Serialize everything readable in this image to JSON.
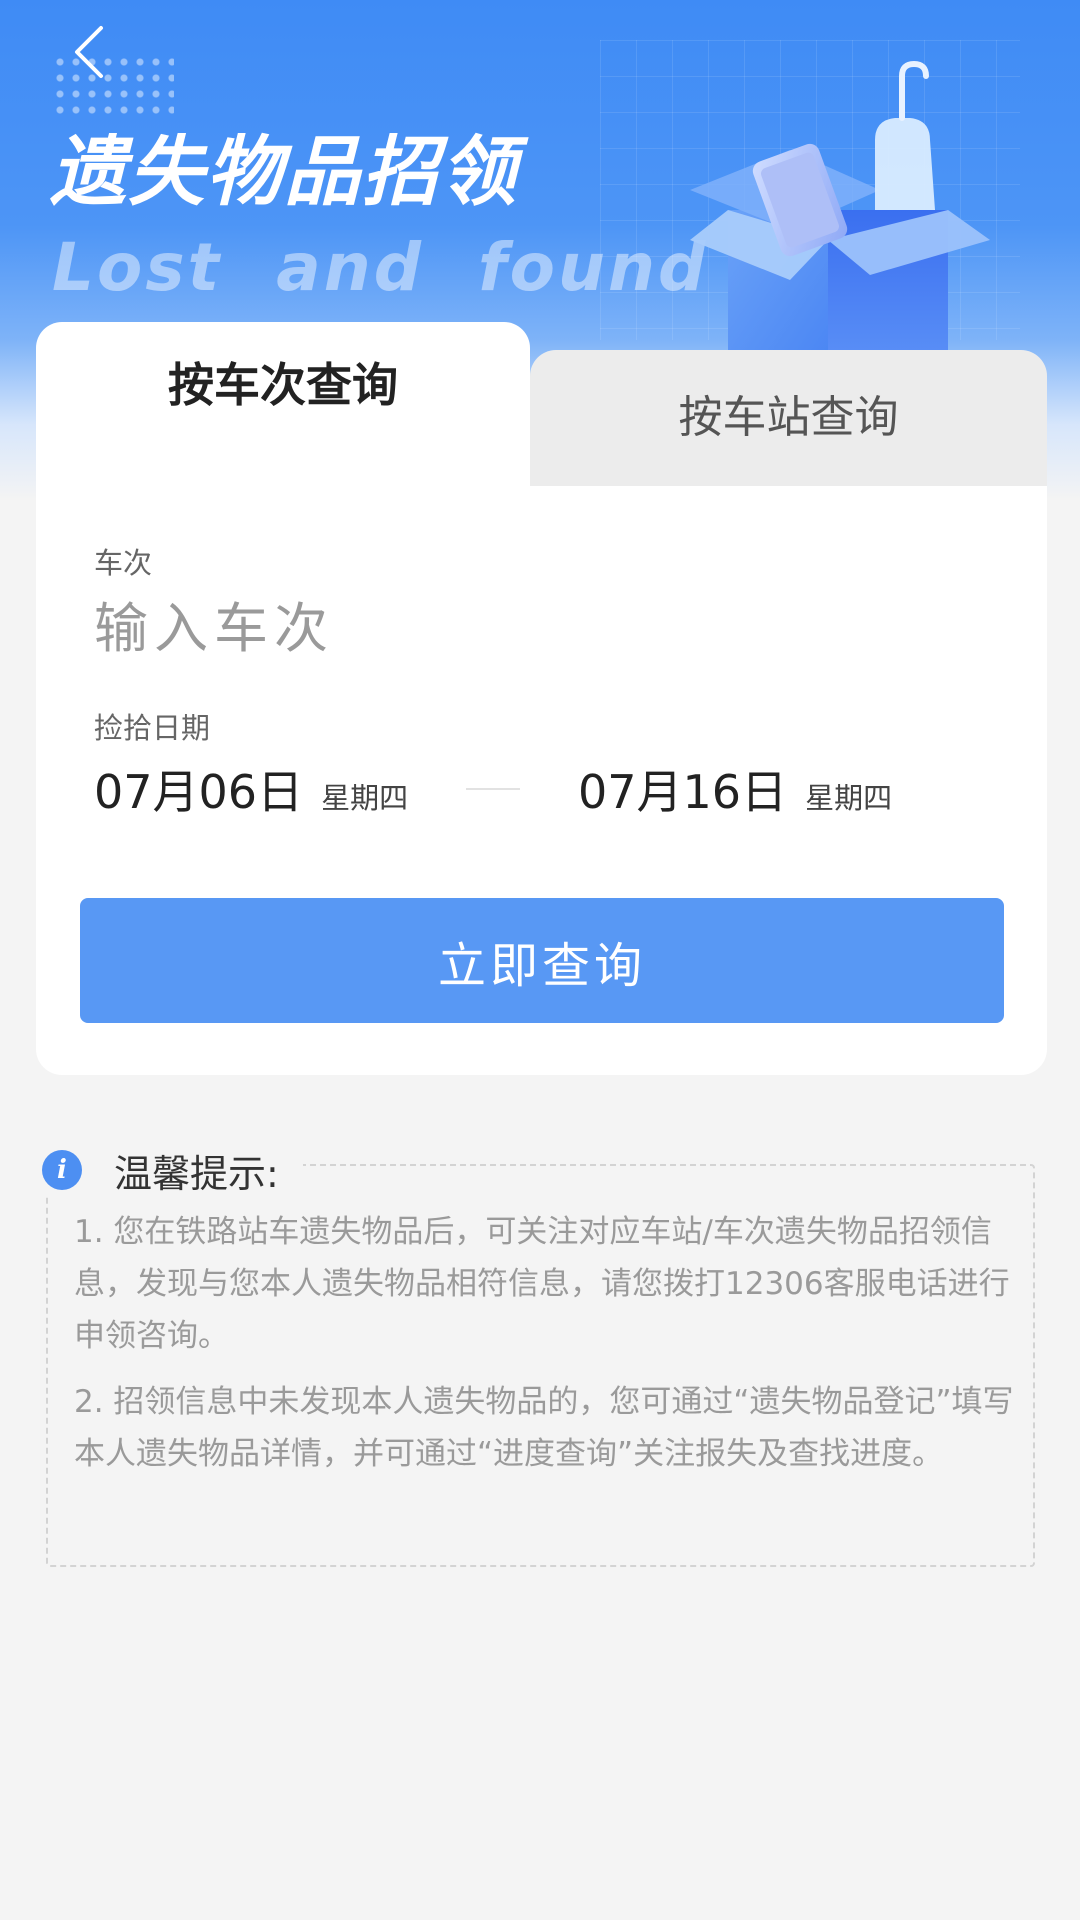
{
  "header": {
    "title_cn": "遗失物品招领",
    "title_en": "Lost and found"
  },
  "tabs": [
    {
      "label": "按车次查询",
      "active": true
    },
    {
      "label": "按车站查询",
      "active": false
    }
  ],
  "form": {
    "train_label": "车次",
    "train_placeholder": "输入车次",
    "train_value": "",
    "date_label": "捡拾日期",
    "start_date": "07月06日",
    "start_weekday": "星期四",
    "end_date": "07月16日",
    "end_weekday": "星期四",
    "submit_label": "立即查询"
  },
  "tips": {
    "title": "温馨提示:",
    "items": [
      "1. 您在铁路站车遗失物品后，可关注对应车站/车次遗失物品招领信息，发现与您本人遗失物品相符信息，请您拨打12306客服电话进行申领咨询。",
      "2. 招领信息中未发现本人遗失物品的，您可通过“遗失物品登记”填写本人遗失物品详情，并可通过“进度查询”关注报失及查找进度。"
    ]
  },
  "colors": {
    "primary": "#5898f4",
    "banner": "#3f8bf5",
    "background": "#f4f4f4"
  }
}
